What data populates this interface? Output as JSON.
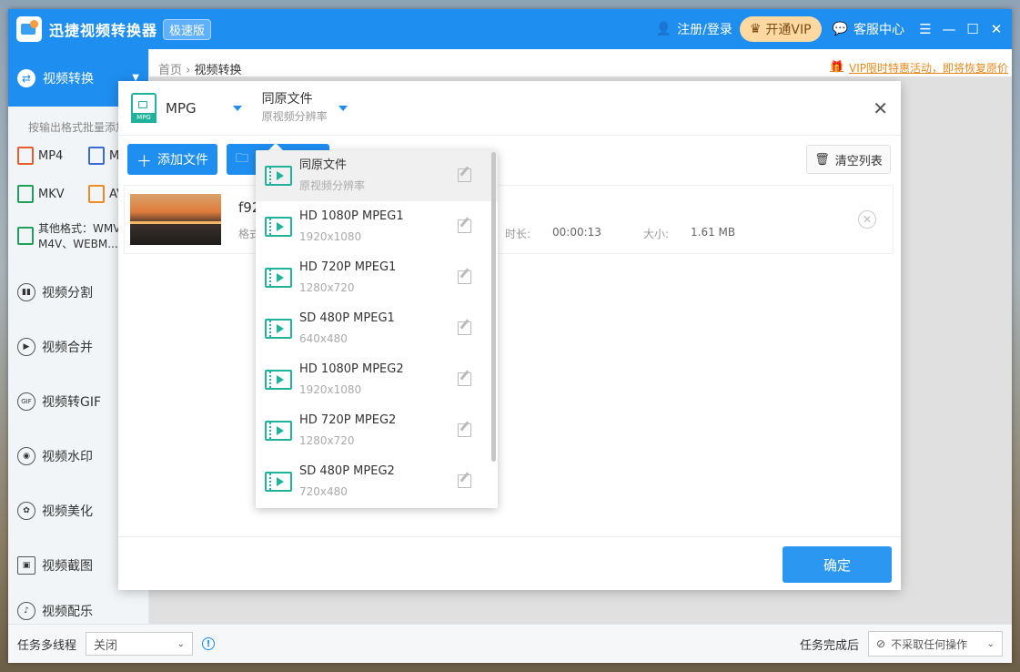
{
  "app": {
    "title": "迅捷视频转换器",
    "edition": "极速版",
    "login": "注册/登录",
    "vip": "开通VIP",
    "service": "客服中心"
  },
  "sidebar": {
    "active": "视频转换",
    "hint": "按输出格式批量添加",
    "formats": [
      {
        "label": "MP4",
        "color": "#e85d2a"
      },
      {
        "label": "MOV",
        "color": "#3a6bd6"
      },
      {
        "label": "MKV",
        "color": "#21a05a"
      },
      {
        "label": "AVI",
        "color": "#f08a24"
      }
    ],
    "other_label": "其他格式：WMV、",
    "other_line2": "M4V、WEBM...",
    "menu": [
      {
        "label": "视频分割",
        "icon": "split-icon",
        "glyph": "▮▮"
      },
      {
        "label": "视频合并",
        "icon": "merge-icon",
        "glyph": "▶"
      },
      {
        "label": "视频转GIF",
        "icon": "gif-icon",
        "glyph": "GIF"
      },
      {
        "label": "视频水印",
        "icon": "watermark-icon",
        "glyph": "◉"
      },
      {
        "label": "视频美化",
        "icon": "beautify-icon",
        "glyph": "✿"
      },
      {
        "label": "视频截图",
        "icon": "screenshot-icon",
        "glyph": "▣"
      },
      {
        "label": "视频配乐",
        "icon": "music-icon",
        "glyph": "♪"
      }
    ]
  },
  "breadcrumb": {
    "home": "首页",
    "current": "视频转换"
  },
  "promo": "VIP限时特惠活动，即将恢复原价",
  "dialog": {
    "format": "MPG",
    "format_icon_label": "MPG",
    "resolution_title": "同原文件",
    "resolution_sub": "原视频分辨率",
    "add_file": "添加文件",
    "clear_list": "清空列表",
    "confirm": "确定"
  },
  "file": {
    "name": "f92",
    "format_label": "格式",
    "duration_label": "时长:",
    "duration": "00:00:13",
    "size_label": "大小:",
    "size": "1.61 MB"
  },
  "dropdown": [
    {
      "title": "同原文件",
      "sub": "原视频分辨率"
    },
    {
      "title": "HD 1080P MPEG1",
      "sub": "1920x1080"
    },
    {
      "title": "HD 720P MPEG1",
      "sub": "1280x720"
    },
    {
      "title": "SD 480P MPEG1",
      "sub": "640x480"
    },
    {
      "title": "HD 1080P MPEG2",
      "sub": "1920x1080"
    },
    {
      "title": "HD 720P MPEG2",
      "sub": "1280x720"
    },
    {
      "title": "SD 480P MPEG2",
      "sub": "720x480"
    }
  ],
  "bottom": {
    "threads_label": "任务多线程",
    "threads_value": "关闭",
    "after_label": "任务完成后",
    "after_value": "不采取任何操作"
  }
}
